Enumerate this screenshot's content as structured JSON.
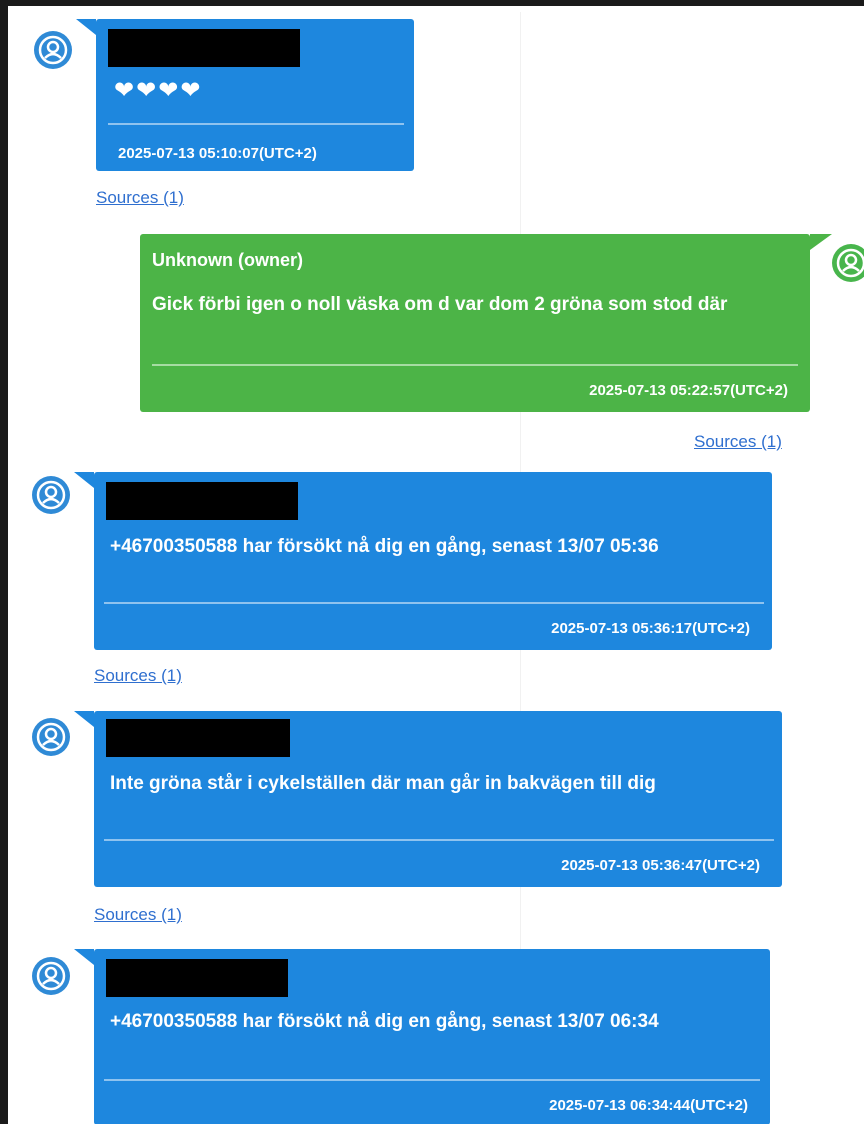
{
  "messages": [
    {
      "direction": "incoming",
      "body": "❤❤❤❤",
      "timestamp": "2025-07-13 05:10:07(UTC+2)",
      "sources": "Sources (1)"
    },
    {
      "direction": "outgoing",
      "sender": "Unknown (owner)",
      "body": "Gick förbi igen o noll väska om d var dom 2 gröna som stod där",
      "timestamp": "2025-07-13 05:22:57(UTC+2)",
      "sources": "Sources (1)"
    },
    {
      "direction": "incoming",
      "body": "+46700350588 har försökt nå dig en gång, senast 13/07 05:36",
      "timestamp": "2025-07-13 05:36:17(UTC+2)",
      "sources": "Sources (1)"
    },
    {
      "direction": "incoming",
      "body": "Inte gröna står i cykelställen där man går in bakvägen till dig",
      "timestamp": "2025-07-13 05:36:47(UTC+2)",
      "sources": "Sources (1)"
    },
    {
      "direction": "incoming",
      "body": "+46700350588 har försökt nå dig en gång, senast 13/07 06:34",
      "timestamp": "2025-07-13 06:34:44(UTC+2)"
    }
  ],
  "colors": {
    "incoming_bubble": "#1e87de",
    "outgoing_bubble": "#4cb447",
    "link": "#2f6fcf"
  },
  "icons": {
    "incoming_avatar": "user-avatar-icon",
    "outgoing_avatar": "user-avatar-icon"
  }
}
